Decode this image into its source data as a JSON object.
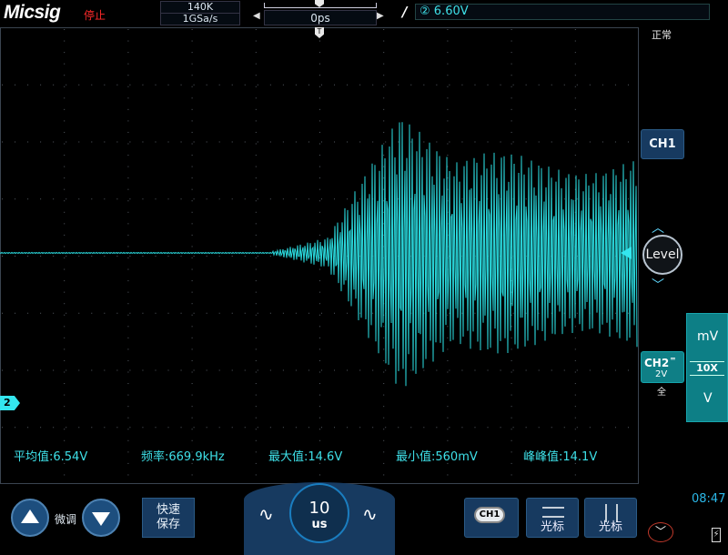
{
  "brand": "Micsig",
  "run_state": "停止",
  "acquisition": {
    "memory_depth": "140K",
    "sample_rate": "1GSa/s"
  },
  "time_position": "0ps",
  "trigger": {
    "slope_glyph": "/",
    "source_level": "② 6.60V",
    "mode": "正常",
    "top_marker": "T"
  },
  "measurements": [
    {
      "label": "平均值:6.54V"
    },
    {
      "label": "频率:669.9kHz"
    },
    {
      "label": "最大值:14.6V"
    },
    {
      "label": "最小值:560mV"
    },
    {
      "label": "峰峰值:14.1V"
    }
  ],
  "right_panel": {
    "ch1_button": "CH1",
    "level_label": "Level",
    "level_up": "︿",
    "level_down": "﹀",
    "ch2": {
      "label": "CH2",
      "coupling": "═",
      "scale": "2V",
      "bandwidth": "全"
    },
    "units": {
      "mv": "mV",
      "probe": "10X",
      "v": "V"
    },
    "clock": "08:47"
  },
  "ch2_marker": "2",
  "bottom_bar": {
    "fine_label": "微调",
    "quick_save": [
      "快速",
      "保存"
    ],
    "timebase_value": "10",
    "timebase_unit": "us",
    "ch1_select": "CH1",
    "cursor1_label": "光标",
    "cursor2_label": "光标"
  },
  "colors": {
    "trace": "#2ad8dc",
    "accent": "#34e6ee",
    "button": "#173a60",
    "ch2_active": "#0f7f86",
    "grid": "#555b63"
  },
  "icons": [
    "up-arrow-icon",
    "down-arrow-icon",
    "sine-wave-icon",
    "cursor-horizontal-icon",
    "cursor-vertical-icon",
    "battery-icon",
    "power-icon"
  ]
}
